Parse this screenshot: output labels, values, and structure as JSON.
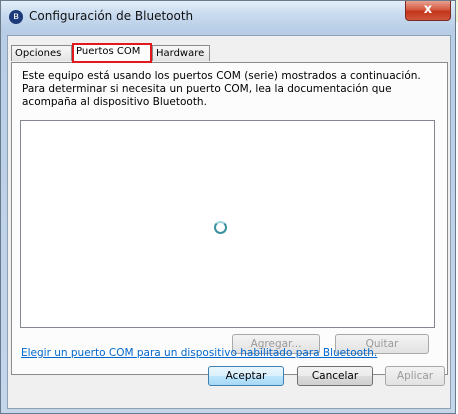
{
  "window": {
    "title": "Configuración de Bluetooth",
    "close_label": "x"
  },
  "tabs": [
    {
      "label": "Opciones",
      "active": false
    },
    {
      "label": "Puertos COM",
      "active": true
    },
    {
      "label": "Hardware",
      "active": false
    }
  ],
  "panel": {
    "description": "Este equipo está usando los puertos COM (serie) mostrados a continuación. Para determinar si necesita un puerto COM, lea la documentación que acompaña al dispositivo Bluetooth.",
    "add_label": "Agregar...",
    "remove_label": "Quitar",
    "help_link": "Elegir un puerto COM para un dispositivo habilitado para Bluetooth."
  },
  "footer": {
    "ok_label": "Aceptar",
    "cancel_label": "Cancelar",
    "apply_label": "Aplicar"
  },
  "colors": {
    "highlight_outline": "#e01a1a",
    "link": "#0066cc",
    "watermark": "#e8f3c8"
  },
  "icons": {
    "title": "bluetooth-icon",
    "loading": "loading-spinner-icon"
  }
}
